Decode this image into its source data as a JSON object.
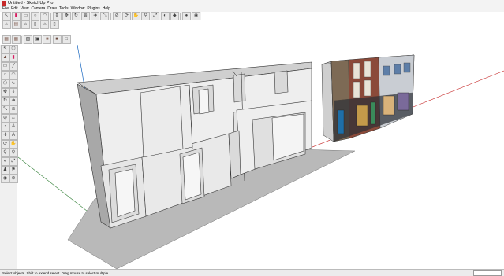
{
  "window": {
    "title": "Untitled - SketchUp Pro"
  },
  "menu": [
    "File",
    "Edit",
    "View",
    "Camera",
    "Draw",
    "Tools",
    "Window",
    "Plugins",
    "Help"
  ],
  "status": {
    "text": "Select objects. Shift to extend select. Drag mouse to select multiple."
  },
  "icons": {
    "row1": [
      "select-icon",
      "eraser-icon",
      "rectangle-icon",
      "circle-icon",
      "arc-icon",
      "push-pull-icon",
      "move-icon",
      "rotate-icon",
      "offset-icon",
      "follow-me-icon",
      "scale-icon",
      "tape-measure-icon",
      "orbit-icon",
      "pan-icon",
      "zoom-icon",
      "zoom-extents-icon",
      "previous-view-icon",
      "next-view-icon",
      "get-models-icon",
      "share-model-icon",
      "components-icon"
    ],
    "row2": [
      "iso-view-icon",
      "top-view-icon",
      "front-view-icon",
      "right-view-icon",
      "back-view-icon",
      "left-view-icon"
    ],
    "row3": [
      "xray-icon",
      "back-edges-icon",
      "wireframe-icon",
      "hidden-line-icon",
      "shaded-icon",
      "shaded-textures-icon",
      "monochrome-icon"
    ],
    "side": [
      "select-icon",
      "make-component-icon",
      "paint-bucket-icon",
      "eraser-icon",
      "rectangle-icon",
      "line-icon",
      "circle-icon",
      "arc-icon",
      "polygon-icon",
      "freehand-icon",
      "move-icon",
      "push-pull-icon",
      "rotate-icon",
      "follow-me-icon",
      "scale-icon",
      "offset-icon",
      "tape-measure-icon",
      "dimension-icon",
      "protractor-icon",
      "text-icon",
      "axes-icon",
      "3d-text-icon",
      "orbit-icon",
      "pan-icon",
      "zoom-icon",
      "zoom-window-icon",
      "previous-view-icon",
      "zoom-extents-icon",
      "position-camera-icon",
      "walk-icon",
      "look-around-icon",
      "section-plane-icon"
    ]
  },
  "colors": {
    "axis_red": "#c62828",
    "axis_green": "#2e7d32",
    "axis_blue": "#1565c0",
    "shadow": "#b9b9b9"
  }
}
